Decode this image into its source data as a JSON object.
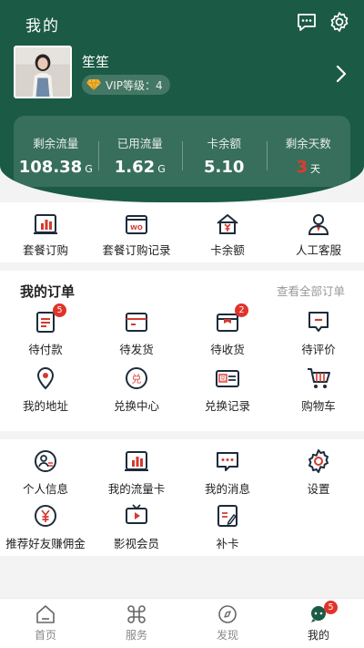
{
  "header": {
    "title": "我的",
    "chat_icon": "message-icon",
    "settings_icon": "gear-icon"
  },
  "profile": {
    "name": "笙笙",
    "vip_label": "VIP等级：4"
  },
  "stats": [
    {
      "label": "剩余流量",
      "value": "108.38",
      "unit": "G"
    },
    {
      "label": "已用流量",
      "value": "1.62",
      "unit": "G"
    },
    {
      "label": "卡余额",
      "value": "5.10",
      "unit": ""
    },
    {
      "label": "剩余天数",
      "value": "3",
      "unit": "天"
    }
  ],
  "quick": [
    {
      "label": "套餐订购",
      "icon": "package-chart-icon"
    },
    {
      "label": "套餐订购记录",
      "icon": "wo-record-icon"
    },
    {
      "label": "卡余额",
      "icon": "yen-house-icon"
    },
    {
      "label": "人工客服",
      "icon": "customer-service-icon"
    }
  ],
  "orders": {
    "title": "我的订单",
    "more": "查看全部订单",
    "row1": [
      {
        "label": "待付款",
        "badge": "5"
      },
      {
        "label": "待发货",
        "badge": ""
      },
      {
        "label": "待收货",
        "badge": "2"
      },
      {
        "label": "待评价",
        "badge": ""
      }
    ],
    "row2": [
      {
        "label": "我的地址"
      },
      {
        "label": "兑换中心"
      },
      {
        "label": "兑换记录"
      },
      {
        "label": "购物车"
      }
    ]
  },
  "services": {
    "row1": [
      {
        "label": "个人信息"
      },
      {
        "label": "我的流量卡"
      },
      {
        "label": "我的消息"
      },
      {
        "label": "设置"
      }
    ],
    "row2": [
      {
        "label": "推荐好友赚佣金"
      },
      {
        "label": "影视会员"
      },
      {
        "label": "补卡"
      }
    ]
  },
  "tabs": [
    {
      "label": "首页"
    },
    {
      "label": "服务"
    },
    {
      "label": "发现"
    },
    {
      "label": "我的",
      "badge": "5"
    }
  ],
  "colors": {
    "brand": "#1b5a44",
    "accent_red": "#e0332b",
    "stat_red": "#e33a2e"
  }
}
